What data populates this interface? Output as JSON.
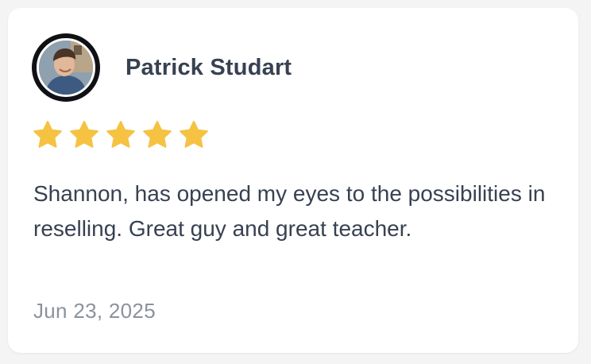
{
  "review": {
    "author_name": "Patrick Studart",
    "avatar": "profile-photo",
    "rating": 5,
    "rating_max": 5,
    "star_color": "#f5c242",
    "text": "Shannon, has opened my eyes to the possibilities in reselling. Great guy and great teacher.",
    "date": "Jun 23, 2025"
  }
}
